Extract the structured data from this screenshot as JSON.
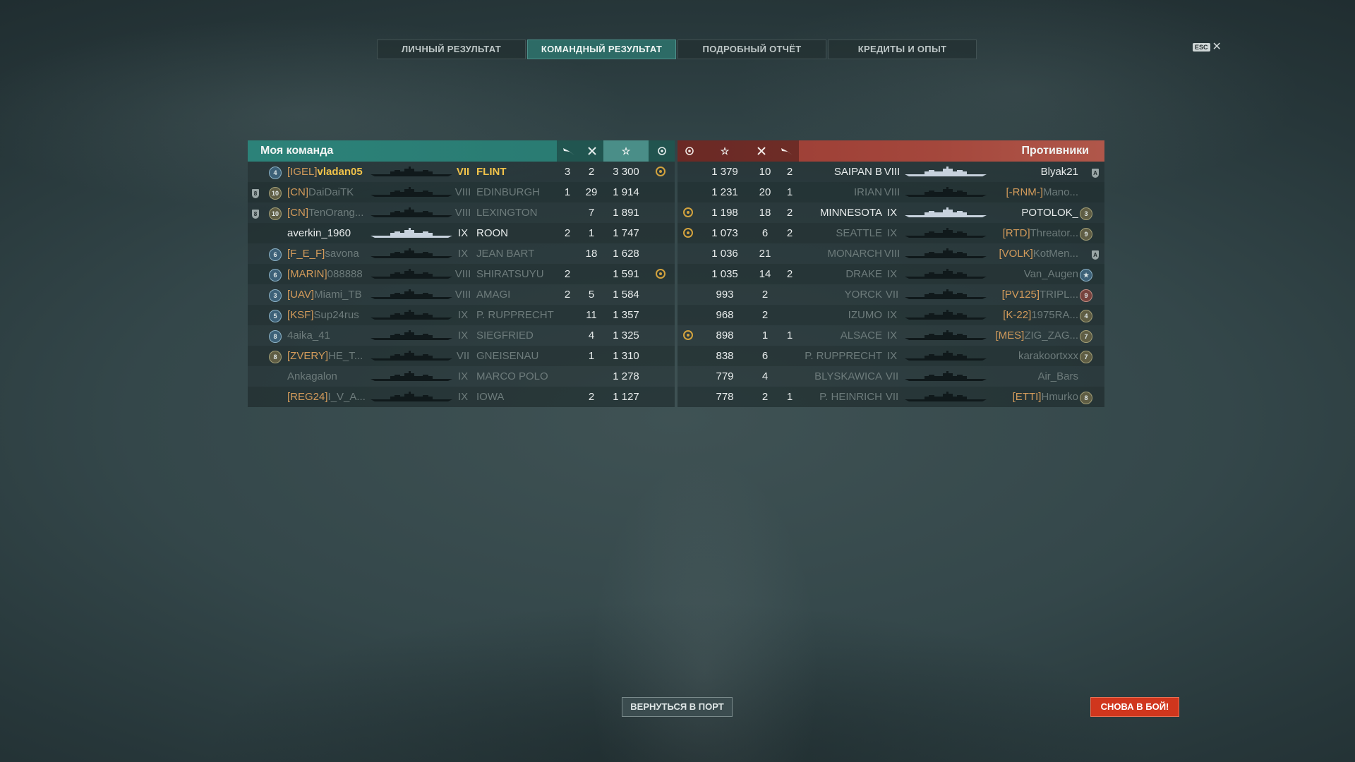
{
  "tabs": [
    {
      "label": "ЛИЧНЫЙ РЕЗУЛЬТАТ",
      "active": false
    },
    {
      "label": "КОМАНДНЫЙ РЕЗУЛЬТАТ",
      "active": true
    },
    {
      "label": "ПОДРОБНЫЙ ОТЧЁТ",
      "active": false
    },
    {
      "label": "КРЕДИТЫ И ОПЫТ",
      "active": false
    }
  ],
  "esc_label": "ESC",
  "my_team": {
    "title": "Моя команда",
    "header_icons": [
      "plane-kill-icon",
      "frag-icon",
      "star-icon",
      "laurel-icon"
    ],
    "rows": [
      {
        "division": "",
        "rank": "4",
        "rank_color": "blue",
        "clan": "[IGEL]",
        "player": "vladan05",
        "tier": "VII",
        "ship": "FLINT",
        "planes": "3",
        "frags": "2",
        "xp": "3 300",
        "medal": true,
        "style": "self"
      },
      {
        "division": "8",
        "rank": "10",
        "rank_color": "olive",
        "clan": "[CN]",
        "player": "DaiDaiTK",
        "tier": "VIII",
        "ship": "EDINBURGH",
        "planes": "1",
        "frags": "29",
        "xp": "1 914",
        "medal": false,
        "style": "dim"
      },
      {
        "division": "8",
        "rank": "10",
        "rank_color": "olive",
        "clan": "[CN]",
        "player": "TenOrang...",
        "tier": "VIII",
        "ship": "LEXINGTON",
        "planes": "",
        "frags": "7",
        "xp": "1 891",
        "medal": false,
        "style": "dim"
      },
      {
        "division": "",
        "rank": "",
        "rank_color": "",
        "clan": "",
        "player": "averkin_1960",
        "tier": "IX",
        "ship": "ROON",
        "planes": "2",
        "frags": "1",
        "xp": "1 747",
        "medal": false,
        "style": "white"
      },
      {
        "division": "",
        "rank": "6",
        "rank_color": "blue",
        "clan": "[F_E_F]",
        "player": "savona",
        "tier": "IX",
        "ship": "JEAN BART",
        "planes": "",
        "frags": "18",
        "xp": "1 628",
        "medal": false,
        "style": "dim"
      },
      {
        "division": "",
        "rank": "6",
        "rank_color": "blue",
        "clan": "[MARIN]",
        "player": "088888",
        "tier": "VIII",
        "ship": "SHIRATSUYU",
        "planes": "2",
        "frags": "",
        "xp": "1 591",
        "medal": true,
        "style": "dim"
      },
      {
        "division": "",
        "rank": "3",
        "rank_color": "blue",
        "clan": "[UAV]",
        "player": "Miami_TB",
        "tier": "VIII",
        "ship": "AMAGI",
        "planes": "2",
        "frags": "5",
        "xp": "1 584",
        "medal": false,
        "style": "dim"
      },
      {
        "division": "",
        "rank": "5",
        "rank_color": "blue",
        "clan": "[KSF]",
        "player": "Sup24rus",
        "tier": "IX",
        "ship": "P. RUPPRECHT",
        "planes": "",
        "frags": "11",
        "xp": "1 357",
        "medal": false,
        "style": "dim"
      },
      {
        "division": "",
        "rank": "8",
        "rank_color": "blue",
        "clan": "",
        "player": "4aika_41",
        "tier": "IX",
        "ship": "SIEGFRIED",
        "planes": "",
        "frags": "4",
        "xp": "1 325",
        "medal": false,
        "style": "dim"
      },
      {
        "division": "",
        "rank": "8",
        "rank_color": "olive",
        "clan": "[ZVERY]",
        "player": "HE_T...",
        "tier": "VII",
        "ship": "GNEISENAU",
        "planes": "",
        "frags": "1",
        "xp": "1 310",
        "medal": false,
        "style": "dim"
      },
      {
        "division": "",
        "rank": "",
        "rank_color": "",
        "clan": "",
        "player": "Ankagalon",
        "tier": "IX",
        "ship": "MARCO POLO",
        "planes": "",
        "frags": "",
        "xp": "1 278",
        "medal": false,
        "style": "dim"
      },
      {
        "division": "",
        "rank": "",
        "rank_color": "",
        "clan": "[REG24]",
        "player": "I_V_A...",
        "tier": "IX",
        "ship": "IOWA",
        "planes": "",
        "frags": "2",
        "xp": "1 127",
        "medal": false,
        "style": "dim"
      }
    ]
  },
  "enemy_team": {
    "title": "Противники",
    "header_icons": [
      "laurel-icon",
      "star-icon",
      "frag-icon",
      "plane-kill-icon"
    ],
    "rows": [
      {
        "medal": false,
        "xp": "1 379",
        "frags": "10",
        "planes": "2",
        "ship": "SAIPAN B",
        "tier": "VIII",
        "clan": "",
        "player": "Blyak21",
        "rank": "",
        "rank_color": "",
        "division": "A",
        "style": "white"
      },
      {
        "medal": false,
        "xp": "1 231",
        "frags": "20",
        "planes": "1",
        "ship": "IRIAN",
        "tier": "VIII",
        "clan": "[-RNM-]",
        "player": "Mano...",
        "rank": "",
        "rank_color": "",
        "division": "",
        "style": "dim"
      },
      {
        "medal": true,
        "xp": "1 198",
        "frags": "18",
        "planes": "2",
        "ship": "MINNESOTA",
        "tier": "IX",
        "clan": "",
        "player": "POTOLOK_",
        "rank": "3",
        "rank_color": "olive",
        "division": "",
        "style": "white"
      },
      {
        "medal": true,
        "xp": "1 073",
        "frags": "6",
        "planes": "2",
        "ship": "SEATTLE",
        "tier": "IX",
        "clan": "[RTD]",
        "player": "Threator...",
        "rank": "9",
        "rank_color": "olive",
        "division": "",
        "style": "dim"
      },
      {
        "medal": false,
        "xp": "1 036",
        "frags": "21",
        "planes": "",
        "ship": "MONARCH",
        "tier": "VIII",
        "clan": "[VOLK]",
        "player": "KotMen...",
        "rank": "",
        "rank_color": "",
        "division": "A",
        "style": "dim"
      },
      {
        "medal": false,
        "xp": "1 035",
        "frags": "14",
        "planes": "2",
        "ship": "DRAKE",
        "tier": "IX",
        "clan": "",
        "player": "Van_Augen",
        "rank": "★",
        "rank_color": "blue",
        "division": "",
        "style": "dim"
      },
      {
        "medal": false,
        "xp": "993",
        "frags": "2",
        "planes": "",
        "ship": "YORCK",
        "tier": "VII",
        "clan": "[PV125]",
        "player": "TRIPL...",
        "rank": "9",
        "rank_color": "red",
        "division": "",
        "style": "dim"
      },
      {
        "medal": false,
        "xp": "968",
        "frags": "2",
        "planes": "",
        "ship": "IZUMO",
        "tier": "IX",
        "clan": "[K-22]",
        "player": "1975RA...",
        "rank": "4",
        "rank_color": "olive",
        "division": "",
        "style": "dim"
      },
      {
        "medal": true,
        "xp": "898",
        "frags": "1",
        "planes": "1",
        "ship": "ALSACE",
        "tier": "IX",
        "clan": "[MES]",
        "player": "ZIG_ZAG...",
        "rank": "7",
        "rank_color": "olive",
        "division": "",
        "style": "dim"
      },
      {
        "medal": false,
        "xp": "838",
        "frags": "6",
        "planes": "",
        "ship": "P. RUPPRECHT",
        "tier": "IX",
        "clan": "",
        "player": "karakoortxxx",
        "rank": "7",
        "rank_color": "olive",
        "division": "",
        "style": "dim"
      },
      {
        "medal": false,
        "xp": "779",
        "frags": "4",
        "planes": "",
        "ship": "BLYSKAWICA",
        "tier": "VII",
        "clan": "",
        "player": "Air_Bars",
        "rank": "",
        "rank_color": "",
        "division": "",
        "style": "dim"
      },
      {
        "medal": false,
        "xp": "778",
        "frags": "2",
        "planes": "1",
        "ship": "P. HEINRICH",
        "tier": "VII",
        "clan": "[ETTI]",
        "player": "Hmurko",
        "rank": "8",
        "rank_color": "olive",
        "division": "",
        "style": "dim"
      }
    ]
  },
  "buttons": {
    "return_port": "ВЕРНУТЬСЯ В ПОРТ",
    "battle_again": "СНОВА В БОЙ!"
  }
}
